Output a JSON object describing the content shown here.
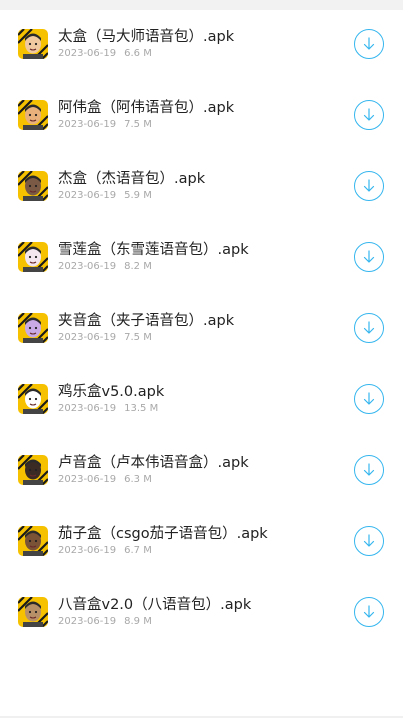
{
  "files": [
    {
      "name": "太盒（马大师语音包）.apk",
      "date": "2023-06-19",
      "size": "6.6 M",
      "avatar": "bald-man-avatar",
      "skin": "#f0c9a0",
      "bg": "#f6c200"
    },
    {
      "name": "阿伟盒（阿伟语音包）.apk",
      "date": "2023-06-19",
      "size": "7.5 M",
      "avatar": "man-red-shirt-avatar",
      "skin": "#e8b07a",
      "bg": "#f6c200"
    },
    {
      "name": "杰盒（杰语音包）.apk",
      "date": "2023-06-19",
      "size": "5.9 M",
      "avatar": "man-glasses-avatar",
      "skin": "#7a5a45",
      "bg": "#f6c200"
    },
    {
      "name": "雪莲盒（东雪莲语音包）.apk",
      "date": "2023-06-19",
      "size": "8.2 M",
      "avatar": "anime-girl-white-hair-avatar",
      "skin": "#f3e6ef",
      "bg": "#f6c200"
    },
    {
      "name": "夹音盒（夹子语音包）.apk",
      "date": "2023-06-19",
      "size": "7.5 M",
      "avatar": "anime-girl-purple-hair-avatar",
      "skin": "#c9a9e6",
      "bg": "#f6c200"
    },
    {
      "name": "鸡乐盒v5.0.apk",
      "date": "2023-06-19",
      "size": "13.5 M",
      "avatar": "panda-avatar",
      "skin": "#ffffff",
      "bg": "#f6c200"
    },
    {
      "name": "卢音盒（卢本伟语音盒）.apk",
      "date": "2023-06-19",
      "size": "6.3 M",
      "avatar": "man-dark-avatar",
      "skin": "#3a2b25",
      "bg": "#f6c200"
    },
    {
      "name": "茄子盒（csgo茄子语音包）.apk",
      "date": "2023-06-19",
      "size": "6.7 M",
      "avatar": "man-blue-shirt-avatar",
      "skin": "#7a5236",
      "bg": "#f6c200"
    },
    {
      "name": "八音盒v2.0（八语音包）.apk",
      "date": "2023-06-19",
      "size": "8.9 M",
      "avatar": "old-man-avatar",
      "skin": "#b89068",
      "bg": "#f6c200"
    }
  ],
  "colors": {
    "accent": "#35b6ee",
    "title": "#222222",
    "meta": "#a8a8a8"
  },
  "download_icon": "download-arrow-icon"
}
